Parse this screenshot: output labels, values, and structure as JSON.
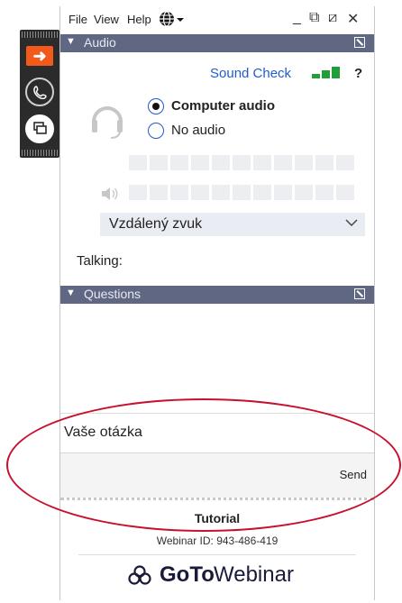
{
  "menu": {
    "file": "File",
    "view": "View",
    "help": "Help"
  },
  "window_controls": {
    "minimize": "_",
    "restore": "⧉",
    "popout": "⧄",
    "close": "✕"
  },
  "audio": {
    "section_title": "Audio",
    "sound_check": "Sound Check",
    "help_glyph": "?",
    "options": [
      {
        "label": "Computer audio",
        "selected": true
      },
      {
        "label": "No audio",
        "selected": false
      }
    ],
    "speaker_dropdown_value": "Vzdálený zvuk",
    "talking_label": "Talking:"
  },
  "questions": {
    "section_title": "Questions",
    "input_placeholder": "Vaše otázka",
    "send_label": "Send"
  },
  "footer": {
    "title": "Tutorial",
    "webinar_id": "Webinar ID: 943-486-419",
    "brand_prefix": "GoTo",
    "brand_suffix": "Webinar"
  },
  "colors": {
    "section_bar": "#5f6783",
    "accent_orange": "#f25a1c",
    "link_blue": "#1f5bd1",
    "meter_green": "#1f9e3a",
    "annotation_red": "#c8102e"
  },
  "icons": {
    "strip_top": "arrow-right-icon",
    "strip_middle": "phone-icon",
    "strip_bottom": "screens-icon",
    "language": "globe-icon",
    "headset": "headset-icon",
    "speaker": "speaker-icon"
  }
}
